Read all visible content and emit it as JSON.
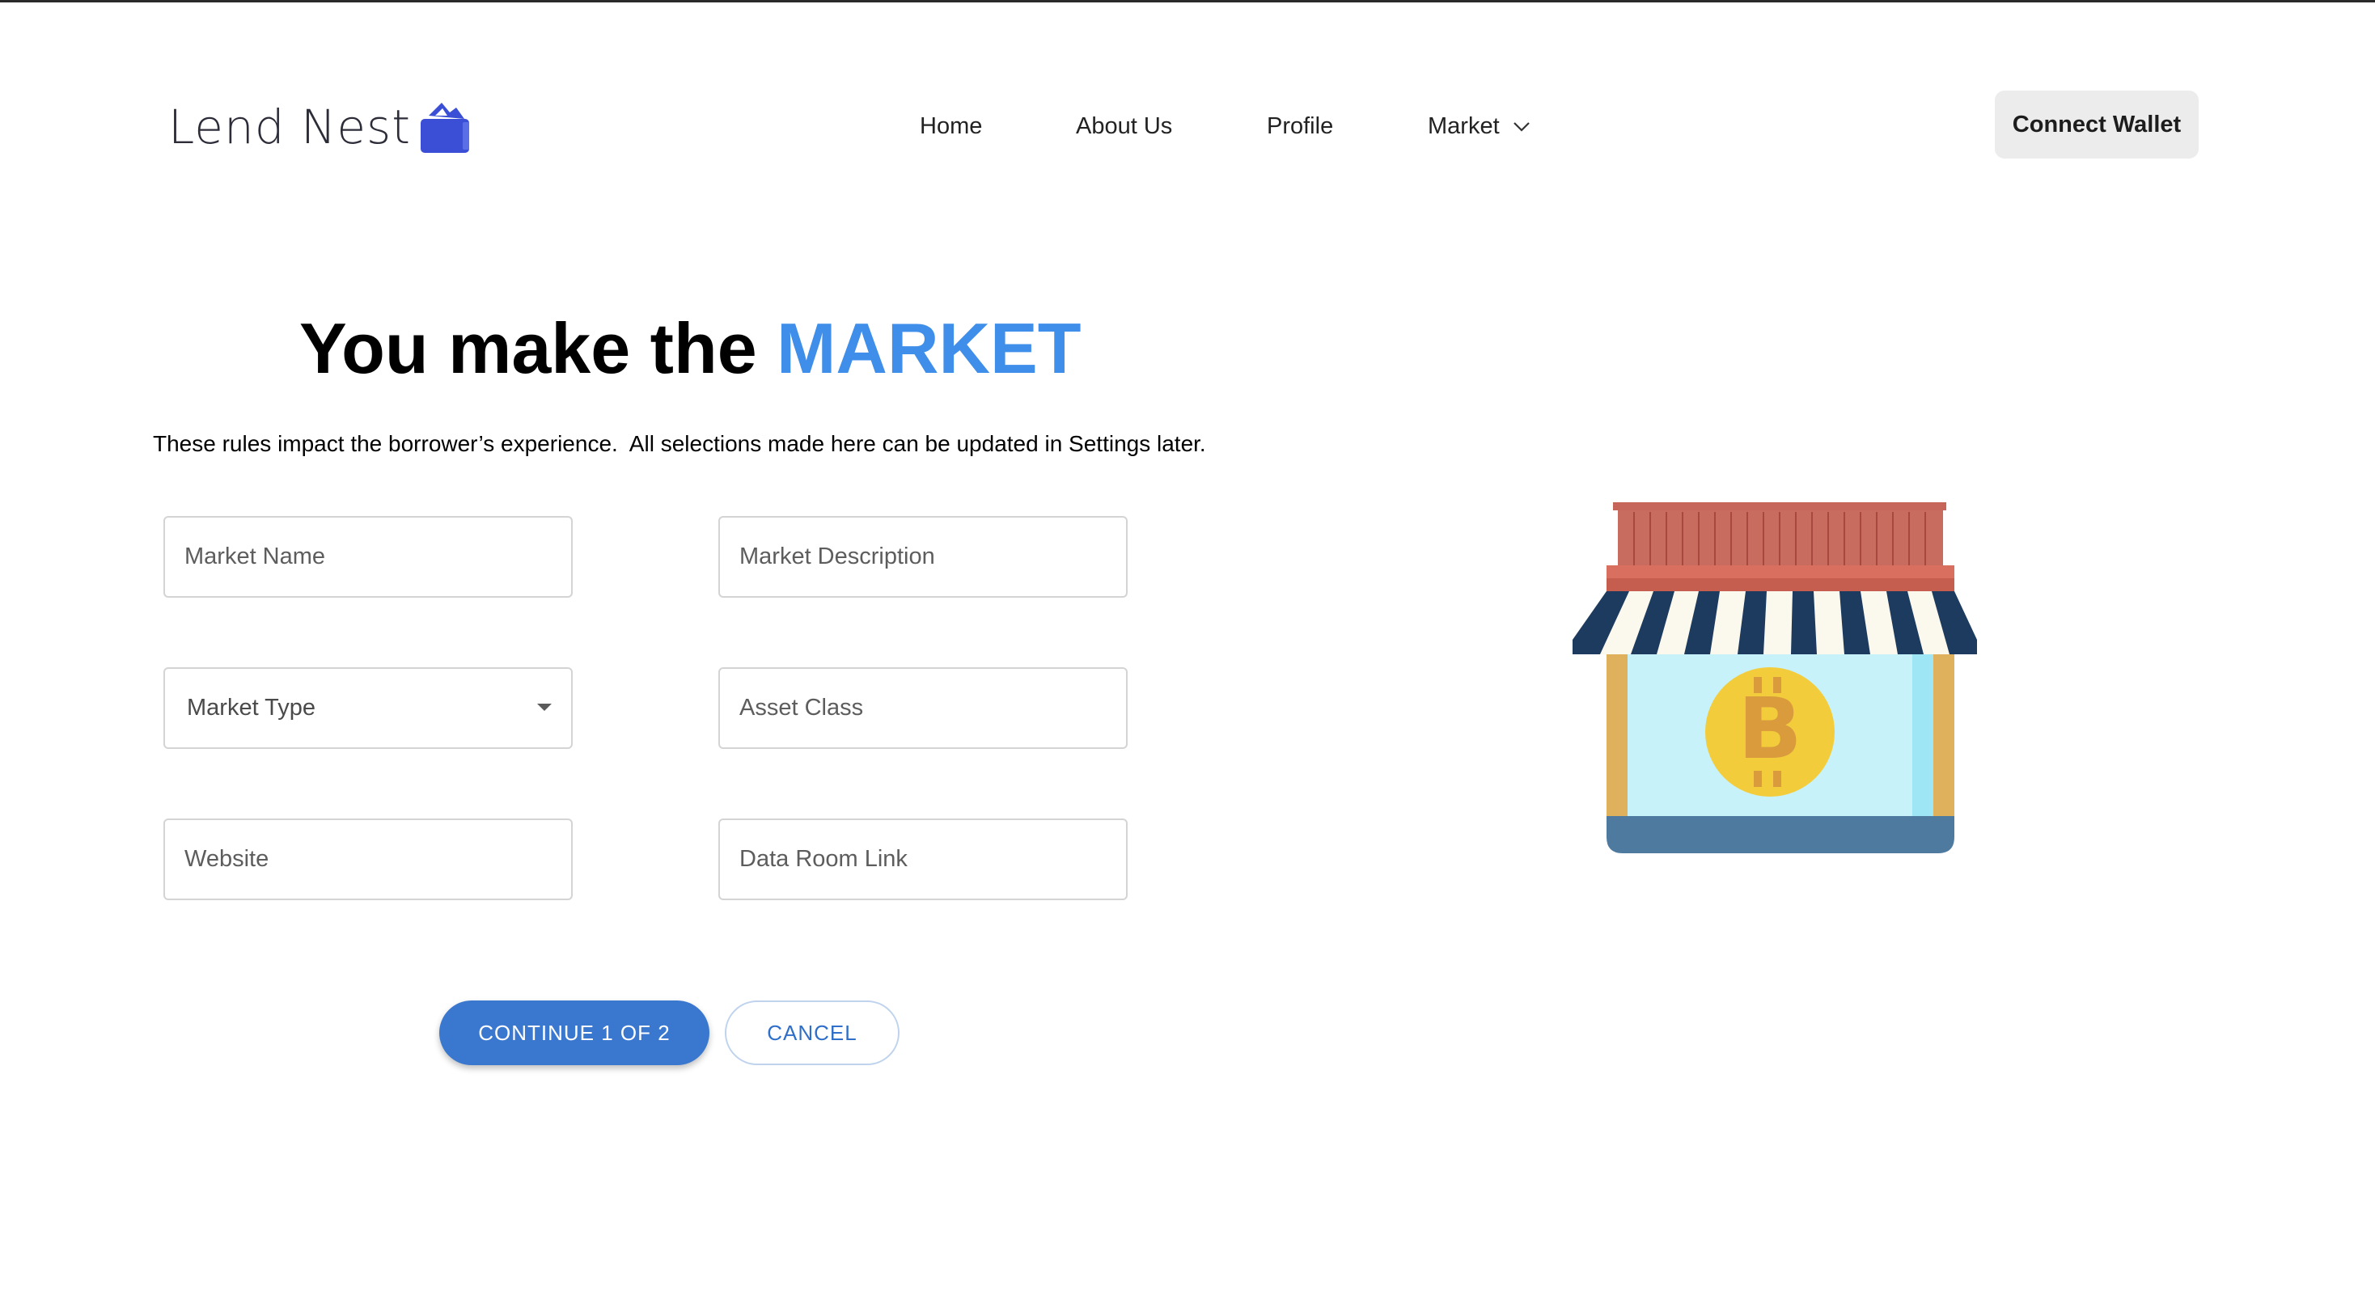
{
  "header": {
    "logo_text": "Lend Nest",
    "nav": {
      "home": "Home",
      "about": "About Us",
      "profile": "Profile",
      "market": "Market"
    },
    "connect_wallet": "Connect Wallet"
  },
  "hero": {
    "headline_prefix": "You make the ",
    "headline_accent": "MARKET",
    "subtitle": "These rules impact the borrower’s experience.  All selections made here can be updated in Settings later."
  },
  "form": {
    "market_name_placeholder": "Market Name",
    "market_description_placeholder": "Market Description",
    "market_type_value": "Market Type",
    "asset_class_placeholder": "Asset Class",
    "website_placeholder": "Website",
    "data_room_placeholder": "Data Room Link"
  },
  "actions": {
    "continue": "CONTINUE 1 OF 2",
    "cancel": "CANCEL"
  },
  "icons": {
    "logo": "wallet-icon",
    "market_dropdown": "chevron-down-icon",
    "select": "caret-down-icon",
    "illustration": "bitcoin-shop-icon"
  },
  "colors": {
    "accent": "#3f8ee9",
    "primary_button": "#3a78d0",
    "logo_blue": "#3a4fd6"
  }
}
